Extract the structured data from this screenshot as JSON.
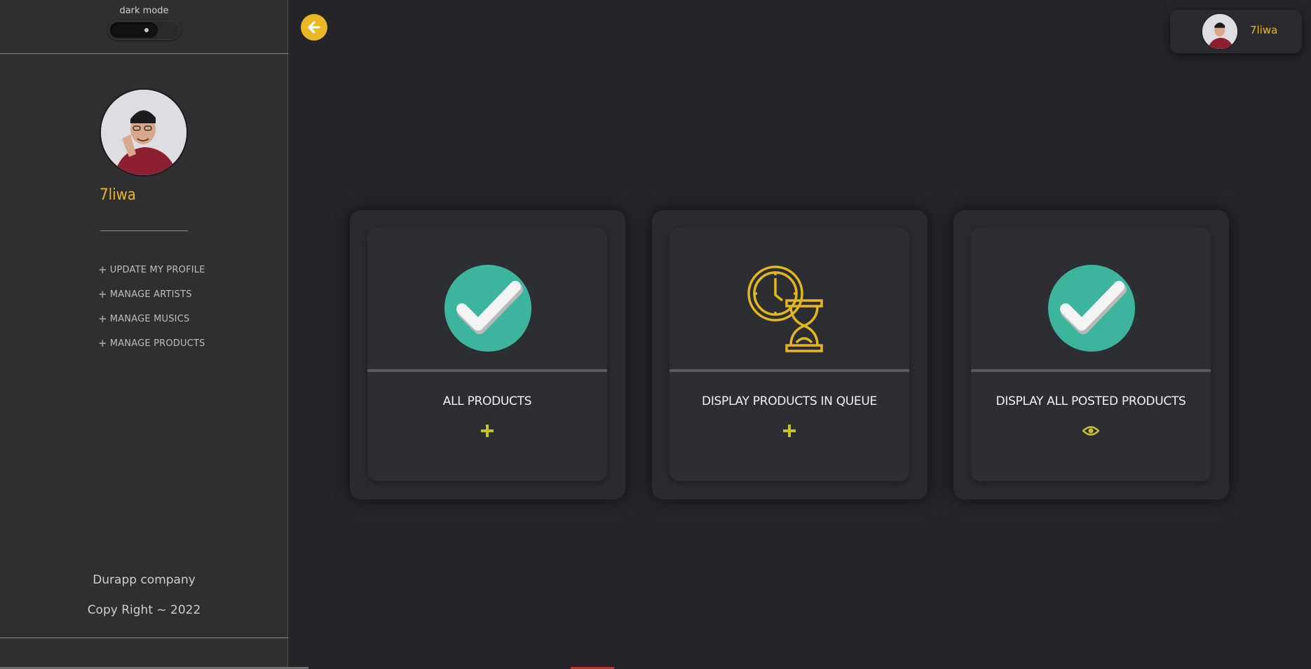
{
  "sidebar": {
    "dark_mode_label": "dark mode",
    "user_name": "7liwa",
    "menu": [
      {
        "label": "UPDATE MY PROFILE"
      },
      {
        "label": "MANAGE ARTISTS"
      },
      {
        "label": "MANAGE MUSICS"
      },
      {
        "label": "MANAGE PRODUCTS"
      }
    ],
    "company": "Durapp company",
    "copyright": "Copy Right ~ 2022"
  },
  "header": {
    "user_name": "7liwa"
  },
  "cards": [
    {
      "title": "ALL PRODUCTS",
      "icon": "check-circle-icon",
      "action_icon": "plus-icon"
    },
    {
      "title": "DISPLAY PRODUCTS IN QUEUE",
      "icon": "clock-hourglass-icon",
      "action_icon": "plus-icon"
    },
    {
      "title": "DISPLAY ALL POSTED PRODUCTS",
      "icon": "check-circle-icon",
      "action_icon": "eye-icon"
    }
  ],
  "colors": {
    "accent": "#e9b824",
    "check_green": "#3db59e",
    "action_yellow": "#c7c12a",
    "background": "#242528",
    "sidebar": "#2f2f31"
  }
}
